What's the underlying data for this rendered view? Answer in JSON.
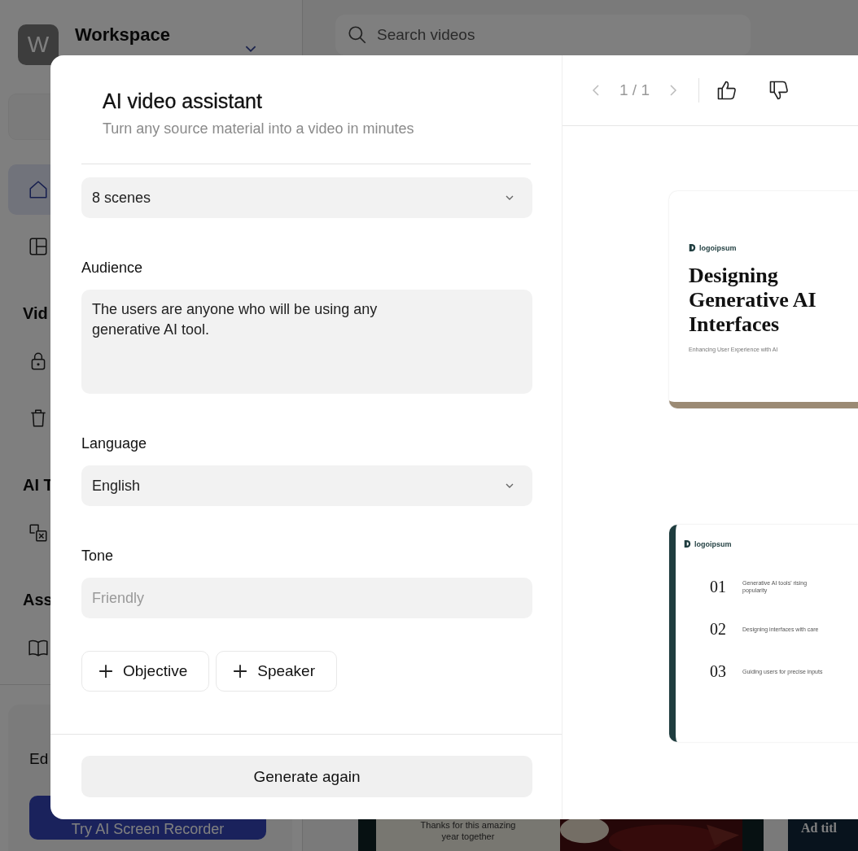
{
  "workspace": {
    "avatar": "W",
    "name": "Workspace"
  },
  "search": {
    "placeholder": "Search videos"
  },
  "sidebar": {
    "nav": [
      {
        "kind": "item",
        "selected": true
      },
      {
        "kind": "item",
        "selected": false
      },
      {
        "kind": "heading",
        "label": "Vid"
      },
      {
        "kind": "item",
        "selected": false
      },
      {
        "kind": "item",
        "selected": false
      },
      {
        "kind": "heading",
        "label": "AI T"
      },
      {
        "kind": "item",
        "selected": false
      },
      {
        "kind": "heading",
        "label": "Ass"
      },
      {
        "kind": "item",
        "selected": false
      }
    ],
    "promo": {
      "title": "Ed",
      "button": "Try AI Screen Recorder"
    }
  },
  "gallery": [
    {
      "kind": "card",
      "caption": "Thanks for this amazing year together"
    },
    {
      "kind": "picture"
    },
    {
      "kind": "title",
      "title": "Ad titl"
    }
  ],
  "dialog": {
    "title": "AI video assistant",
    "subtitle": "Turn any source material into a video in minutes",
    "fields": [
      {
        "kind": "select",
        "value": "8 scenes"
      },
      {
        "kind": "textarea",
        "label": "Audience",
        "value": "The users are anyone who will be using any generative AI tool."
      },
      {
        "kind": "select",
        "label": "Language",
        "value": "English"
      },
      {
        "kind": "input",
        "label": "Tone",
        "placeholder": "Friendly"
      }
    ],
    "add_buttons": [
      "Objective",
      "Speaker"
    ],
    "primary_button": "Generate again",
    "preview": {
      "pager": "1 / 1",
      "slides": [
        {
          "kind": "cover",
          "logo": "logoipsum",
          "title": "Designing Generative AI Interfaces",
          "subtitle": "Enhancing User Experience with AI"
        },
        {
          "kind": "agenda",
          "logo": "logoipsum",
          "items": [
            {
              "number": "01",
              "text": "Generative AI tools' rising popularity"
            },
            {
              "number": "02",
              "text": "Designing interfaces with care"
            },
            {
              "number": "03",
              "text": "Guiding users for precise inputs"
            }
          ]
        }
      ]
    }
  }
}
